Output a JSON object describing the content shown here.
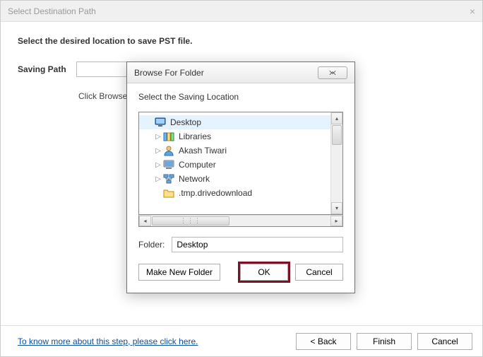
{
  "window": {
    "title": "Select Destination Path"
  },
  "main": {
    "instruction": "Select the desired location to save PST file.",
    "saving_path_label": "Saving Path",
    "saving_path_value": "",
    "helper_text": "Click Browse an",
    "link_text": "To know more about this step, please click here.",
    "buttons": {
      "back": "< Back",
      "finish": "Finish",
      "cancel": "Cancel"
    }
  },
  "dialog": {
    "title": "Browse For Folder",
    "message": "Select the Saving Location",
    "tree": [
      {
        "label": "Desktop",
        "icon": "monitor",
        "selected": true,
        "expander": ""
      },
      {
        "label": "Libraries",
        "icon": "libraries",
        "selected": false,
        "expander": "▷"
      },
      {
        "label": "Akash Tiwari",
        "icon": "user",
        "selected": false,
        "expander": "▷"
      },
      {
        "label": "Computer",
        "icon": "computer",
        "selected": false,
        "expander": "▷"
      },
      {
        "label": "Network",
        "icon": "network",
        "selected": false,
        "expander": "▷"
      },
      {
        "label": ".tmp.drivedownload",
        "icon": "folder",
        "selected": false,
        "expander": ""
      }
    ],
    "folder_label": "Folder:",
    "folder_value": "Desktop",
    "buttons": {
      "make_new": "Make New Folder",
      "ok": "OK",
      "cancel": "Cancel"
    }
  }
}
